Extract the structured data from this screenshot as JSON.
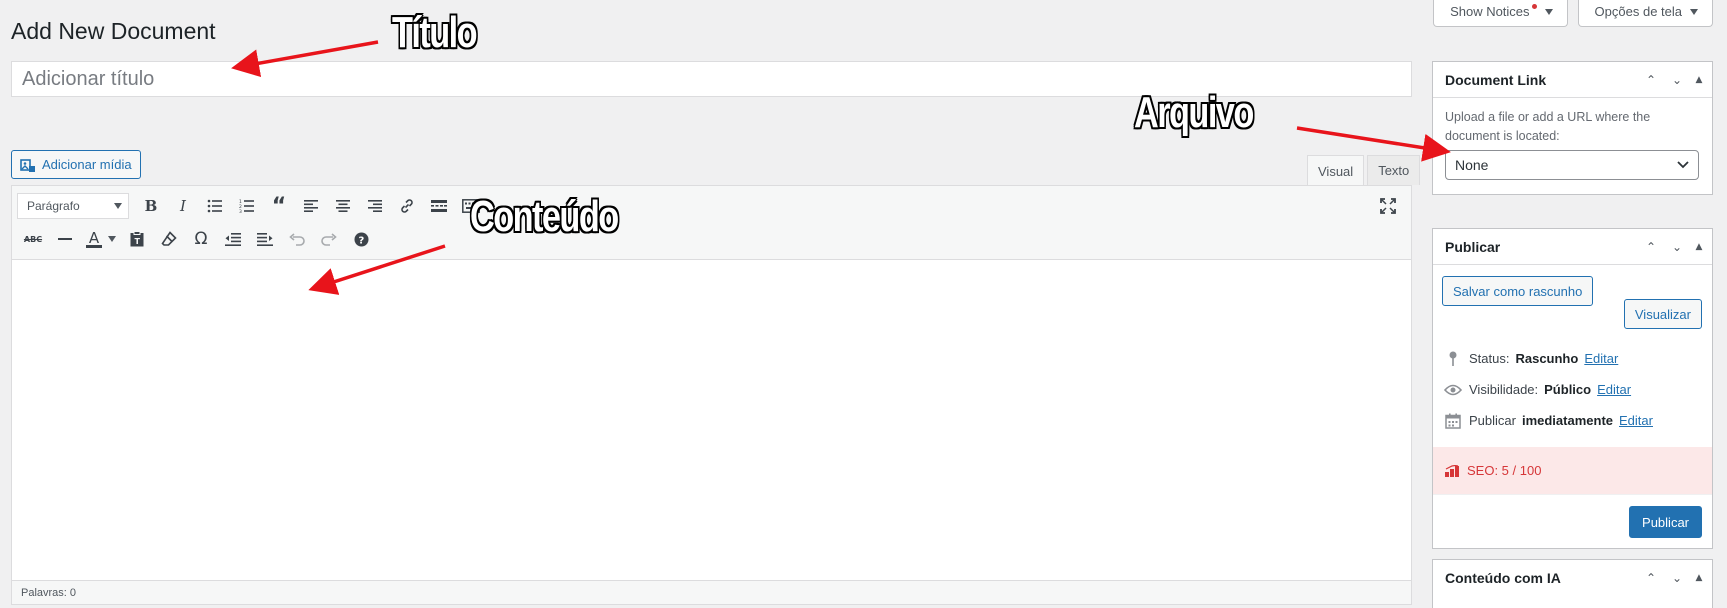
{
  "page": {
    "title": "Add New Document"
  },
  "screen_tabs": {
    "notices": "Show Notices",
    "options": "Opções de tela"
  },
  "post_title": {
    "placeholder": "Adicionar título"
  },
  "editor": {
    "media_button": "Adicionar mídia",
    "tabs": [
      "Visual",
      "Texto"
    ],
    "format_select": "Parágrafo",
    "word_count": "Palavras: 0"
  },
  "document_link": {
    "title": "Document Link",
    "help": "Upload a file or add a URL where the document is located:",
    "select_value": "None"
  },
  "publish": {
    "title": "Publicar",
    "save_draft": "Salvar como rascunho",
    "preview": "Visualizar",
    "status_label": "Status:",
    "status_value": "Rascunho",
    "visibility_label": "Visibilidade:",
    "visibility_value": "Público",
    "schedule_label": "Publicar",
    "schedule_value": "imediatamente",
    "edit_link": "Editar",
    "seo": "SEO: 5 / 100",
    "publish_button": "Publicar"
  },
  "ai_box": {
    "title": "Conteúdo com IA"
  },
  "annotations": {
    "title": "Título",
    "file": "Arquivo",
    "content": "Conteúdo"
  },
  "colors": {
    "accent": "#2271b1",
    "background": "#f0f0f1",
    "seo_alert": "#d63638",
    "annotation_arrow": "#e8141b"
  }
}
